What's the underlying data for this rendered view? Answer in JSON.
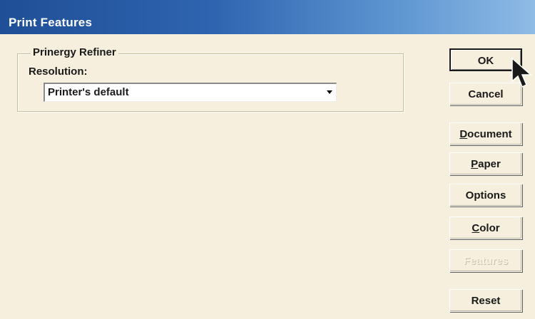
{
  "dialog": {
    "title": "Print Features"
  },
  "group": {
    "legend": "Prinergy Refiner",
    "resolution_label": "Resolution:",
    "resolution_value": "Printer's default"
  },
  "buttons": {
    "ok": "OK",
    "cancel": "Cancel",
    "document": "Document",
    "paper": "Paper",
    "options": "Options",
    "color": "Color",
    "features": "Features",
    "reset": "Reset"
  },
  "icons": {
    "dropdown": "chevron-down-icon",
    "cursor": "mouse-pointer-icon"
  },
  "colors": {
    "title_bar_start": "#1f4f96",
    "title_bar_end": "#8fbbe6",
    "dialog_background": "#f6efde"
  }
}
